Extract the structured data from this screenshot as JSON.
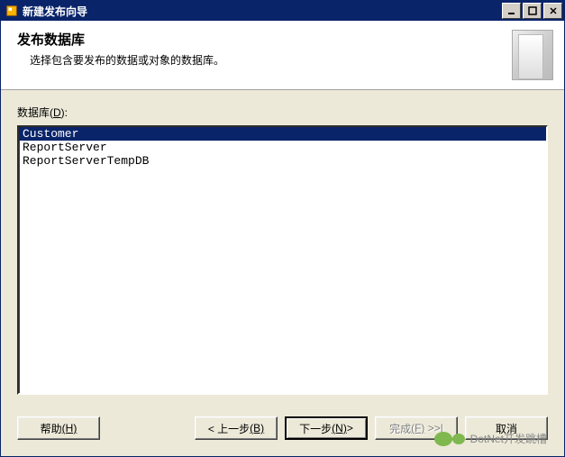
{
  "window": {
    "title": "新建发布向导"
  },
  "header": {
    "title": "发布数据库",
    "subtitle": "选择包含要发布的数据或对象的数据库。"
  },
  "content": {
    "list_label_prefix": "数据库(",
    "list_label_ak": "D",
    "list_label_suffix": "):",
    "databases": [
      {
        "name": "Customer",
        "selected": true
      },
      {
        "name": "ReportServer",
        "selected": false
      },
      {
        "name": "ReportServerTempDB",
        "selected": false
      }
    ]
  },
  "buttons": {
    "help": {
      "label": "帮助",
      "ak": "(H)"
    },
    "back": {
      "label": "< 上一步",
      "ak": "(B)"
    },
    "next": {
      "label": "下一步",
      "ak": "(N)",
      "suffix": " >"
    },
    "finish": {
      "label": "完成",
      "ak": "(F)"
    },
    "cancel": {
      "label": "取消"
    }
  },
  "watermark": "DotNet开发跳槽"
}
